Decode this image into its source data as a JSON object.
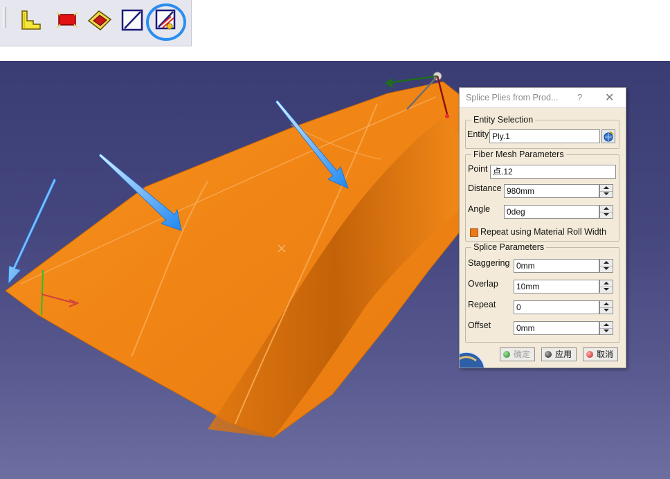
{
  "toolbar": {
    "buttons": [
      {
        "icon": "step-profile-icon"
      },
      {
        "icon": "red-rectangle-icon"
      },
      {
        "icon": "diamond-surface-icon"
      },
      {
        "icon": "diagonal-frame-icon"
      },
      {
        "icon": "splice-plies-icon",
        "highlighted": true
      }
    ],
    "highlight_color": "#2a8ef0"
  },
  "dialog": {
    "title": "Splice Plies from Prod...",
    "help": "?",
    "close": "✕",
    "entity_selection": {
      "legend": "Entity Selection",
      "entity_label": "Entity",
      "entity_value": "Ply.1"
    },
    "fiber_mesh": {
      "legend": "Fiber Mesh Parameters",
      "point_label": "Point",
      "point_value": "点.12",
      "distance_label": "Distance",
      "distance_value": "980mm",
      "angle_label": "Angle",
      "angle_value": "0deg",
      "repeat_checkbox_label": "Repeat using Material Roll Width",
      "repeat_checked": true
    },
    "splice": {
      "legend": "Splice Parameters",
      "staggering_label": "Staggering",
      "staggering_value": "0mm",
      "overlap_label": "Overlap",
      "overlap_value": "10mm",
      "repeat_label": "Repeat",
      "repeat_value": "0",
      "offset_label": "Offset",
      "offset_value": "0mm"
    },
    "buttons": {
      "ok": "确定",
      "apply": "应用",
      "cancel": "取消"
    }
  },
  "colors": {
    "surface": "#f28a1a",
    "background_top": "#3a3c74",
    "arrow": "#2b8ef0",
    "dialog_bg": "#f3ead9"
  }
}
